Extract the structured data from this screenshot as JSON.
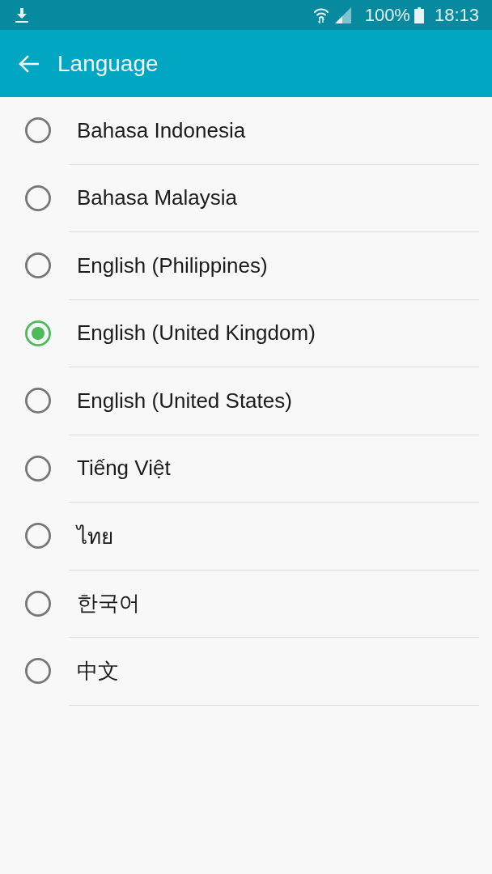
{
  "status_bar": {
    "battery": "100%",
    "time": "18:13"
  },
  "app_bar": {
    "title": "Language"
  },
  "languages": [
    {
      "label": "Bahasa Indonesia",
      "selected": false
    },
    {
      "label": "Bahasa Malaysia",
      "selected": false
    },
    {
      "label": "English (Philippines)",
      "selected": false
    },
    {
      "label": "English (United Kingdom)",
      "selected": true
    },
    {
      "label": "English (United States)",
      "selected": false
    },
    {
      "label": "Tiếng Việt",
      "selected": false
    },
    {
      "label": "ไทย",
      "selected": false
    },
    {
      "label": "한국어",
      "selected": false
    },
    {
      "label": "中文",
      "selected": false
    }
  ]
}
